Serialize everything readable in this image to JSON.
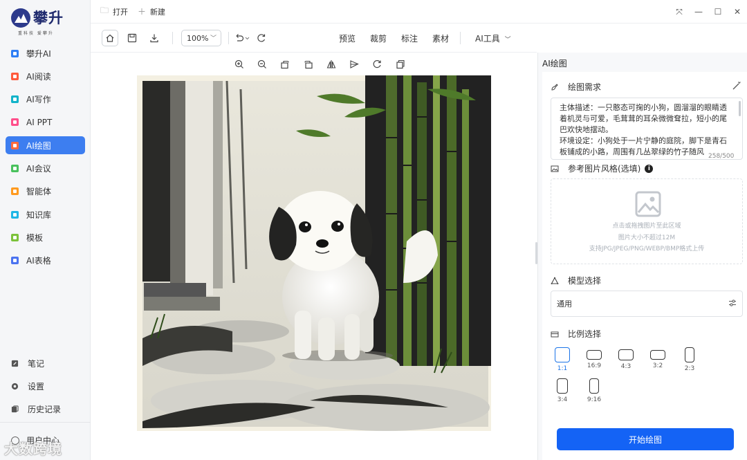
{
  "app": {
    "logo_text": "攀升",
    "slogan": "重科技 爱攀升"
  },
  "sidebar": {
    "items": [
      {
        "label": "攀升AI",
        "color": "#2f7ff5"
      },
      {
        "label": "AI阅读",
        "color": "#ff5a3c"
      },
      {
        "label": "AI写作",
        "color": "#13b3c9"
      },
      {
        "label": "AI PPT",
        "color": "#ff4f8b"
      },
      {
        "label": "AI绘图",
        "color": "#ff6a3d"
      },
      {
        "label": "AI会议",
        "color": "#49c15d"
      },
      {
        "label": "智能体",
        "color": "#ff9a1f"
      },
      {
        "label": "知识库",
        "color": "#1fb6e6"
      },
      {
        "label": "模板",
        "color": "#7cc23b"
      },
      {
        "label": "AI表格",
        "color": "#4b73f0"
      }
    ],
    "active_index": 4,
    "bottom_items": [
      {
        "label": "笔记",
        "icon": "notes-icon"
      },
      {
        "label": "设置",
        "icon": "gear-icon"
      },
      {
        "label": "历史记录",
        "icon": "history-icon"
      }
    ],
    "user_label": "用户中心",
    "watermark": "大数跨境"
  },
  "titlebar": {
    "open_label": "打开",
    "new_label": "新建"
  },
  "toolbar": {
    "zoom": "100%",
    "menus": [
      "预览",
      "裁剪",
      "标注",
      "素材"
    ],
    "ai_tools_label": "AI工具"
  },
  "panel": {
    "tab_label": "AI绘图",
    "prompt_title": "绘图需求",
    "prompt_text": "主体描述：一只憨态可掬的小狗，圆溜溜的眼睛透着机灵与可爱，毛茸茸的耳朵微微耷拉，短小的尾巴欢快地摆动。\n环境设定：小狗处于一片宁静的庭院，脚下是青石板铺成的小路，周围有几丛翠绿的竹子随风",
    "counter": "258/500",
    "ref_title": "参考图片风格(选填)",
    "upload_hint": "点击或拖拽图片至此区域",
    "upload_size": "图片大小不超过12M",
    "upload_formats": "支持JPG/JPEG/PNG/WEBP/BMP格式上传",
    "model_title": "模型选择",
    "model_value": "通用",
    "ratio_title": "比例选择",
    "ratios": [
      "1:1",
      "16:9",
      "4:3",
      "3:2",
      "2:3",
      "3:4",
      "9:16"
    ],
    "selected_ratio": "1:1",
    "start_button": "开始绘图"
  },
  "colors": {
    "accent": "#3d7ef0",
    "primary_button": "#1463f5",
    "selected_ratio": "#1a73e8"
  }
}
